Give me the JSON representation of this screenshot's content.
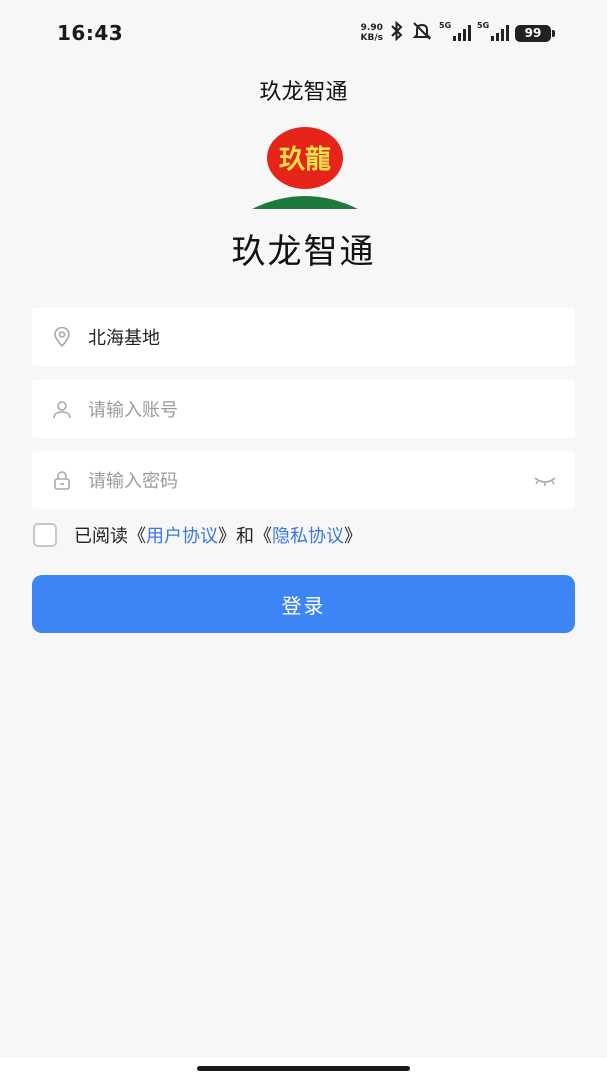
{
  "status_bar": {
    "time": "16:43",
    "net_speed_value": "9.90",
    "net_speed_unit": "KB/s",
    "signal1_label": "5G",
    "signal2_label": "5G",
    "battery": "99"
  },
  "header": {
    "title": "玖龙智通"
  },
  "logo": {
    "text": "玖龍",
    "colors": {
      "circle": "#e52519",
      "text": "#f5e04a",
      "hill": "#1e7a3a"
    }
  },
  "app_name": "玖龙智通",
  "form": {
    "base_value": "北海基地",
    "account_placeholder": "请输入账号",
    "password_placeholder": "请输入密码"
  },
  "agreement": {
    "prefix": "已阅读《",
    "user_agreement": "用户协议",
    "middle": "》和《",
    "privacy_agreement": "隐私协议",
    "suffix": "》"
  },
  "login_button": "登录",
  "colors": {
    "accent": "#3d85f5",
    "link": "#3a78e0",
    "background": "#f7f7f7"
  },
  "icons": [
    "location-icon",
    "user-icon",
    "lock-icon",
    "eye-closed-icon",
    "bluetooth-icon",
    "muted-bell-icon"
  ]
}
